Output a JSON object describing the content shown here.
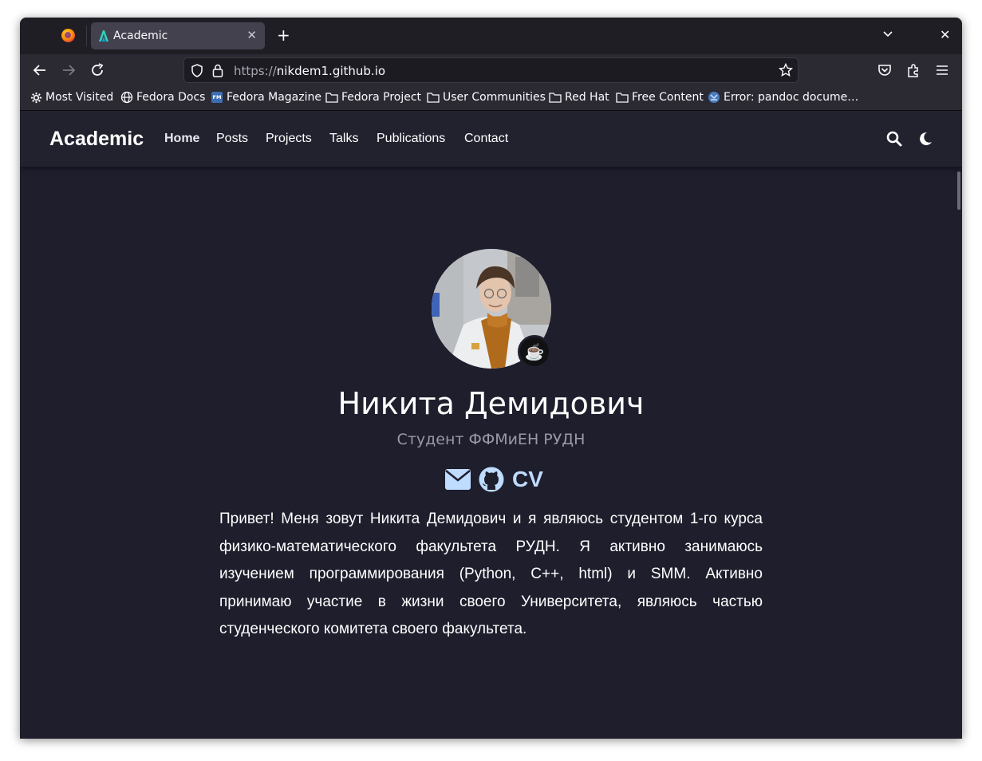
{
  "browser": {
    "tab_title": "Academic",
    "url_scheme": "https://",
    "url_host": "nikdem1.github.io",
    "bookmarks": [
      {
        "label": "Most Visited",
        "icon": "gear-icon"
      },
      {
        "label": "Fedora Docs",
        "icon": "globe-icon"
      },
      {
        "label": "Fedora Magazine",
        "icon": "fm-icon"
      },
      {
        "label": "Fedora Project",
        "icon": "folder-icon"
      },
      {
        "label": "User Communities",
        "icon": "folder-icon"
      },
      {
        "label": "Red Hat",
        "icon": "folder-icon"
      },
      {
        "label": "Free Content",
        "icon": "folder-icon"
      },
      {
        "label": "Error: pandoc docume…",
        "icon": "page-favicon-icon"
      }
    ]
  },
  "site": {
    "brand": "Academic",
    "nav": [
      "Home",
      "Posts",
      "Projects",
      "Talks",
      "Publications",
      "Contact"
    ],
    "active_nav": "Home"
  },
  "profile": {
    "name": "Никита Демидович",
    "role": "Студент ФФМиЕН РУДН",
    "cv_label": "CV",
    "badge_emoji": "☕",
    "bio": "Привет! Меня зовут Никита Демидович и я являюсь студентом 1-го курса физико-математического факультета РУДН. Я активно занимаюсь изучением программирования (Python, C++, html) и SMM. Активно принимаю участие в жизни своего Университета, являюсь частью студенческого комитета своего факультета."
  },
  "colors": {
    "page_bg": "#1e1e2d",
    "nav_bg": "#22222f",
    "accent_icons": "#bfdbfe"
  }
}
